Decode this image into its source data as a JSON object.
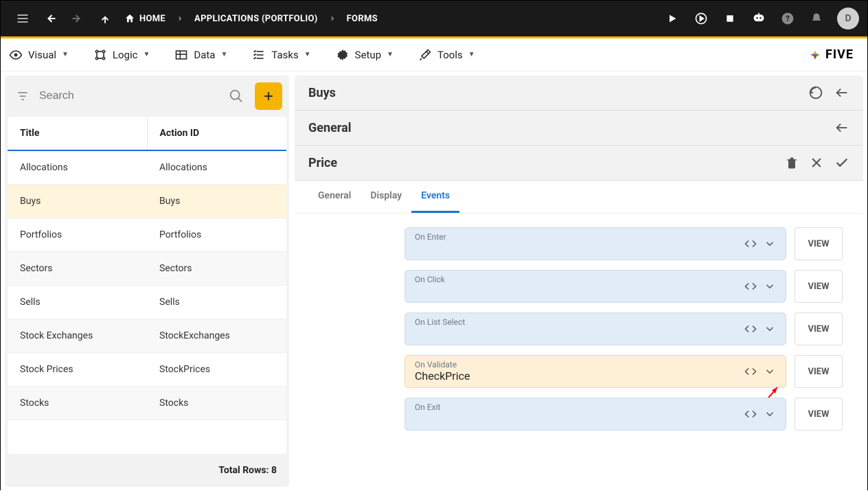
{
  "topbar": {
    "breadcrumbs": [
      "HOME",
      "APPLICATIONS (PORTFOLIO)",
      "FORMS"
    ],
    "avatar_initial": "D"
  },
  "menubar": {
    "items": [
      "Visual",
      "Logic",
      "Data",
      "Tasks",
      "Setup",
      "Tools"
    ],
    "logo_text": "FIVE"
  },
  "search": {
    "placeholder": "Search"
  },
  "table": {
    "headers": [
      "Title",
      "Action ID"
    ],
    "rows": [
      {
        "title": "Allocations",
        "action_id": "Allocations",
        "selected": false
      },
      {
        "title": "Buys",
        "action_id": "Buys",
        "selected": true
      },
      {
        "title": "Portfolios",
        "action_id": "Portfolios",
        "selected": false
      },
      {
        "title": "Sectors",
        "action_id": "Sectors",
        "selected": false
      },
      {
        "title": "Sells",
        "action_id": "Sells",
        "selected": false
      },
      {
        "title": "Stock Exchanges",
        "action_id": "StockExchanges",
        "selected": false
      },
      {
        "title": "Stock Prices",
        "action_id": "StockPrices",
        "selected": false
      },
      {
        "title": "Stocks",
        "action_id": "Stocks",
        "selected": false
      }
    ],
    "footer": "Total Rows: 8"
  },
  "detail": {
    "header1": "Buys",
    "header2": "General",
    "header3": "Price",
    "tabs": [
      "General",
      "Display",
      "Events"
    ],
    "active_tab": "Events",
    "events": [
      {
        "label": "On Enter",
        "value": "",
        "highlight": false
      },
      {
        "label": "On Click",
        "value": "",
        "highlight": false
      },
      {
        "label": "On List Select",
        "value": "",
        "highlight": false
      },
      {
        "label": "On Validate",
        "value": "CheckPrice",
        "highlight": true
      },
      {
        "label": "On Exit",
        "value": "",
        "highlight": false
      }
    ],
    "view_label": "VIEW"
  }
}
